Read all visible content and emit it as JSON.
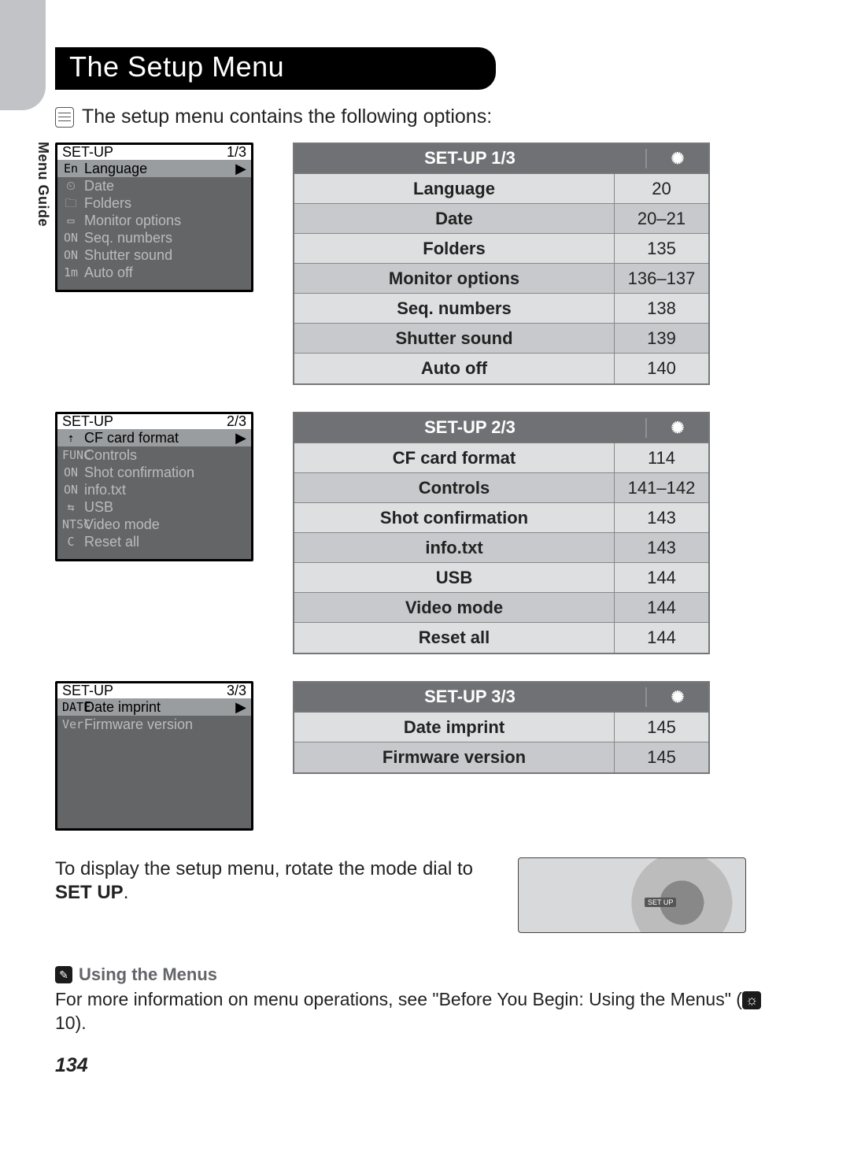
{
  "title": "The Setup Menu",
  "intro": "The setup menu contains the following options:",
  "side_tab": "Menu Guide",
  "lcds": [
    {
      "header_title": "SET-UP",
      "header_page": "1/3",
      "rows": [
        {
          "icon": "En",
          "text": "Language",
          "sel": true,
          "arrow": true
        },
        {
          "icon": "⏲",
          "text": "Date"
        },
        {
          "icon": "🗀",
          "text": "Folders"
        },
        {
          "icon": "▭",
          "text": "Monitor options"
        },
        {
          "icon": "ON",
          "text": "Seq. numbers"
        },
        {
          "icon": "ON",
          "text": "Shutter sound"
        },
        {
          "icon": "1m",
          "text": "Auto off"
        }
      ]
    },
    {
      "header_title": "SET-UP",
      "header_page": "2/3",
      "rows": [
        {
          "icon": "⇡",
          "text": "CF card format",
          "sel": true,
          "arrow": true
        },
        {
          "icon": "FUNC",
          "text": "Controls"
        },
        {
          "icon": "ON",
          "text": "Shot confirmation"
        },
        {
          "icon": "ON",
          "text": "info.txt"
        },
        {
          "icon": "⇆",
          "text": "USB"
        },
        {
          "icon": "NTSC",
          "text": "Video mode"
        },
        {
          "icon": "C",
          "text": "Reset all"
        }
      ]
    },
    {
      "header_title": "SET-UP",
      "header_page": "3/3",
      "rows": [
        {
          "icon": "DATE",
          "text": "Date imprint",
          "sel": true,
          "arrow": true
        },
        {
          "icon": "Ver",
          "text": "Firmware version"
        }
      ]
    }
  ],
  "tables": [
    {
      "header": "SET-UP 1/3",
      "rows": [
        {
          "label": "Language",
          "page": "20"
        },
        {
          "label": "Date",
          "page": "20–21"
        },
        {
          "label": "Folders",
          "page": "135"
        },
        {
          "label": "Monitor options",
          "page": "136–137"
        },
        {
          "label": "Seq. numbers",
          "page": "138"
        },
        {
          "label": "Shutter sound",
          "page": "139"
        },
        {
          "label": "Auto off",
          "page": "140"
        }
      ]
    },
    {
      "header": "SET-UP 2/3",
      "rows": [
        {
          "label": "CF card format",
          "page": "114"
        },
        {
          "label": "Controls",
          "page": "141–142"
        },
        {
          "label": "Shot confirmation",
          "page": "143"
        },
        {
          "label": "info.txt",
          "page": "143"
        },
        {
          "label": "USB",
          "page": "144"
        },
        {
          "label": "Video mode",
          "page": "144"
        },
        {
          "label": "Reset all",
          "page": "144"
        }
      ]
    },
    {
      "header": "SET-UP 3/3",
      "rows": [
        {
          "label": "Date imprint",
          "page": "145"
        },
        {
          "label": "Firmware version",
          "page": "145"
        }
      ]
    }
  ],
  "instruction_pre": "To display the setup menu, rotate the mode dial to ",
  "instruction_bold": "SET UP",
  "instruction_post": ".",
  "note_title": "Using the Menus",
  "note_body_pre": "For more information on menu operations, see \"Before You Begin: Using the Menus\" (",
  "note_page_ref": "10",
  "note_body_post": ").",
  "page_number": "134",
  "hdr_icon_glyph": "✺"
}
